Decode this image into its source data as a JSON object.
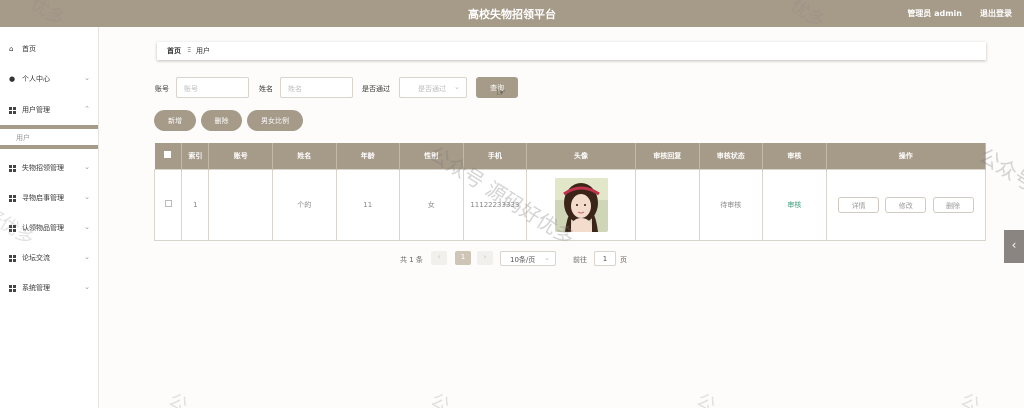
{
  "header": {
    "title": "高校失物招领平台",
    "admin_label": "管理员 admin",
    "logout_label": "退出登录"
  },
  "sidebar": {
    "items": [
      {
        "icon": "home-icon",
        "label": "首页"
      },
      {
        "icon": "user-icon",
        "label": "个人中心"
      },
      {
        "icon": "grid-icon",
        "label": "用户管理"
      },
      {
        "icon": "grid-icon",
        "label": "失物招领管理"
      },
      {
        "icon": "grid-icon",
        "label": "寻物启事管理"
      },
      {
        "icon": "grid-icon",
        "label": "认领物品管理"
      },
      {
        "icon": "grid-icon",
        "label": "论坛交流"
      },
      {
        "icon": "grid-icon",
        "label": "系统管理"
      }
    ],
    "active_sub": "用户"
  },
  "breadcrumb": {
    "home": "首页",
    "separator": "Ξ",
    "current": "用户"
  },
  "filters": {
    "account_label": "账号",
    "account_placeholder": "账号",
    "name_label": "姓名",
    "name_placeholder": "姓名",
    "passed_label": "是否通过",
    "passed_placeholder": "是否通过",
    "query_label": "查询"
  },
  "actions": {
    "add": "新增",
    "delete": "删除",
    "ratio": "男女比例"
  },
  "table": {
    "headers": [
      "索引",
      "账号",
      "姓名",
      "年龄",
      "性别",
      "手机",
      "头像",
      "审核回复",
      "审核状态",
      "审核",
      "操作"
    ],
    "rows": [
      {
        "index": "1",
        "account": "",
        "name": "个的",
        "age": "11",
        "gender": "女",
        "phone": "11122233333",
        "reply": "",
        "status": "待审核",
        "audit": "审核",
        "detail": "详情",
        "edit": "修改",
        "remove": "删除"
      }
    ]
  },
  "pagination": {
    "total": "共 1 条",
    "current": "1",
    "page_size": "10条/页",
    "goto": "前往",
    "page_input": "1",
    "page_unit": "页"
  },
  "watermark": {
    "text1": "公众号 源码好优多",
    "text2": "公众号 源码好优多"
  },
  "colors": {
    "primary": "#a69a89",
    "audit": "#3b9c74"
  }
}
